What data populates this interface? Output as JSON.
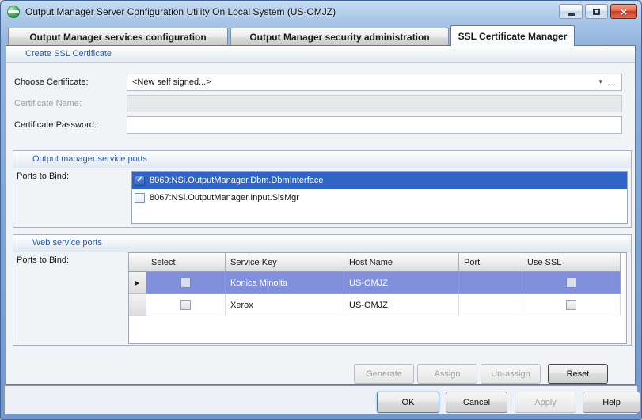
{
  "window": {
    "title": "Output Manager Server Configuration Utility On Local System (US-OMJZ)",
    "icons": {
      "close": "×",
      "dropdown": "▾",
      "ellipsis": "…",
      "row_indicator": "▶",
      "check": "✓"
    }
  },
  "tabs": [
    {
      "label": "Output Manager services configuration",
      "active": false
    },
    {
      "label": "Output Manager security administration",
      "active": false
    },
    {
      "label": "SSL Certificate Manager",
      "active": true
    }
  ],
  "create_ssl": {
    "header": "Create SSL Certificate",
    "choose_certificate": {
      "label": "Choose Certificate:",
      "value": "<New self signed...>"
    },
    "certificate_name": {
      "label": "Certificate Name:",
      "value": "",
      "disabled": true
    },
    "certificate_password": {
      "label": "Certificate Password:",
      "value": ""
    }
  },
  "service_ports": {
    "header": "Output manager service ports",
    "bind_label": "Ports to Bind:",
    "items": [
      {
        "label": "8069:NSi.OutputManager.Dbm.DbmInterface",
        "checked": true,
        "selected": true
      },
      {
        "label": "8067:NSi.OutputManager.Input.SisMgr",
        "checked": false,
        "selected": false
      }
    ]
  },
  "web_ports": {
    "header": "Web service ports",
    "bind_label": "Ports to Bind:",
    "columns": [
      "Select",
      "Service Key",
      "Host Name",
      "Port",
      "Use SSL"
    ],
    "rows": [
      {
        "select": false,
        "service_key": "Konica Minolta",
        "host_name": "US-OMJZ",
        "port": "",
        "use_ssl": false,
        "selected": true
      },
      {
        "select": false,
        "service_key": "Xerox",
        "host_name": "US-OMJZ",
        "port": "",
        "use_ssl": false,
        "selected": false
      }
    ]
  },
  "action_buttons": [
    {
      "label": "Generate",
      "enabled": false
    },
    {
      "label": "Assign",
      "enabled": false
    },
    {
      "label": "Un-assign",
      "enabled": false
    },
    {
      "label": "Reset",
      "enabled": true
    }
  ],
  "dialog_buttons": [
    {
      "label": "OK",
      "enabled": true
    },
    {
      "label": "Cancel",
      "enabled": true
    },
    {
      "label": "Apply",
      "enabled": false
    },
    {
      "label": "Help",
      "enabled": true
    }
  ],
  "colors": {
    "selection_blue": "#2f63c4",
    "grid_selection_blue": "#8090dd",
    "group_header_text": "#2b5aa5",
    "close_button_red": "#cc3a20",
    "app_icon_green": "#2f9e4f"
  }
}
